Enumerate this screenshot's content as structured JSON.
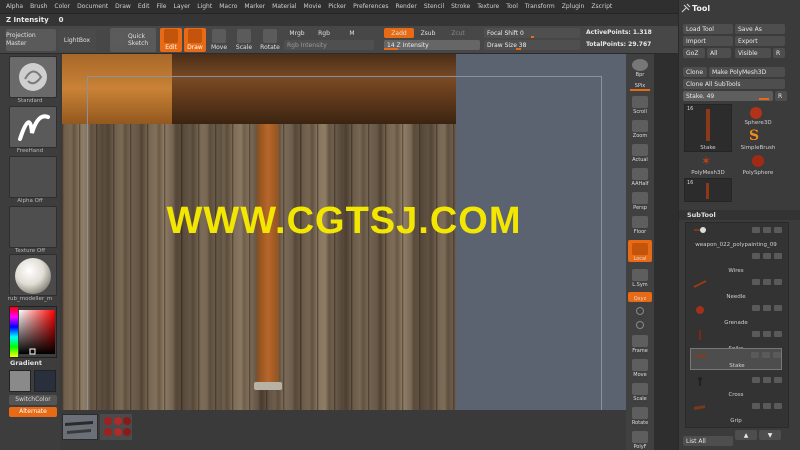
{
  "menu": [
    "Alpha",
    "Brush",
    "Color",
    "Document",
    "Draw",
    "Edit",
    "File",
    "Layer",
    "Light",
    "Macro",
    "Marker",
    "Material",
    "Movie",
    "Picker",
    "Preferences",
    "Render",
    "Stencil",
    "Stroke",
    "Texture",
    "Tool",
    "Transform",
    "Zplugin",
    "Zscript"
  ],
  "title": {
    "label": "Z Intensity",
    "value": "0"
  },
  "shelf": {
    "projection_master": "Projection Master",
    "lightbox": "LightBox",
    "quick_sketch": "Quick Sketch",
    "edit": "Edit",
    "draw": "Draw",
    "move": "Move",
    "scale": "Scale",
    "rotate": "Rotate",
    "mrgb": "Mrgb",
    "rgb": "Rgb",
    "m": "M",
    "rgb_intensity": "Rgb Intensity",
    "zadd": "Zadd",
    "zsub": "Zsub",
    "zcut": "Zcut",
    "z_intensity_slider": "14   Z Intensity",
    "focal_shift": "Focal Shift 0",
    "draw_size": "Draw Size 38",
    "active_points": "ActivePoints: 1.318",
    "total_points": "TotalPoints: 29.767"
  },
  "left_tray": {
    "standard": "Standard",
    "freehand": "FreeHand",
    "alpha_off": "Alpha Off",
    "texture_off": "Texture Off",
    "material": "rub_modeller_m",
    "gradient": "Gradient",
    "switch_color": "SwitchColor",
    "alternate": "Alternate"
  },
  "canvas": {
    "watermark": "WWW.CGTSJ.COM"
  },
  "right_shelf": [
    "Bpr",
    "SPix",
    "Scroll",
    "Zoom",
    "Actual",
    "AAHalf",
    "Persp",
    "Floor",
    "Local",
    "L.Sym",
    "Qxyz",
    "",
    "",
    "Frame",
    "Move",
    "Scale",
    "Rotate",
    "PolyF"
  ],
  "tool": {
    "title": "Tool",
    "load_tool": "Load Tool",
    "save_as": "Save As",
    "import": "Import",
    "export": "Export",
    "goz": "GoZ",
    "all": "All",
    "visible": "Visible",
    "r": "R",
    "clone": "Clone",
    "make_polymesh": "Make PolyMesh3D",
    "clone_all_subtools": "Clone  All SubTools",
    "stake": "Stake. 49",
    "thumb_count": "16",
    "thumb_count2": "16",
    "tools": [
      "Stake",
      "Sphere3D",
      "SimpleBrush",
      "PolyMesh3D",
      "PolySphere",
      "Stake"
    ],
    "subtool_title": "SubTool",
    "subtools": [
      "weapon_022_polypainting_09",
      "Wires",
      "Needle",
      "Grenade",
      "Spike",
      "Stake",
      "Cross",
      "Grip"
    ],
    "list_all": "List All"
  },
  "colors": {
    "accent": "#e86a14",
    "watermark": "#f3e600"
  }
}
